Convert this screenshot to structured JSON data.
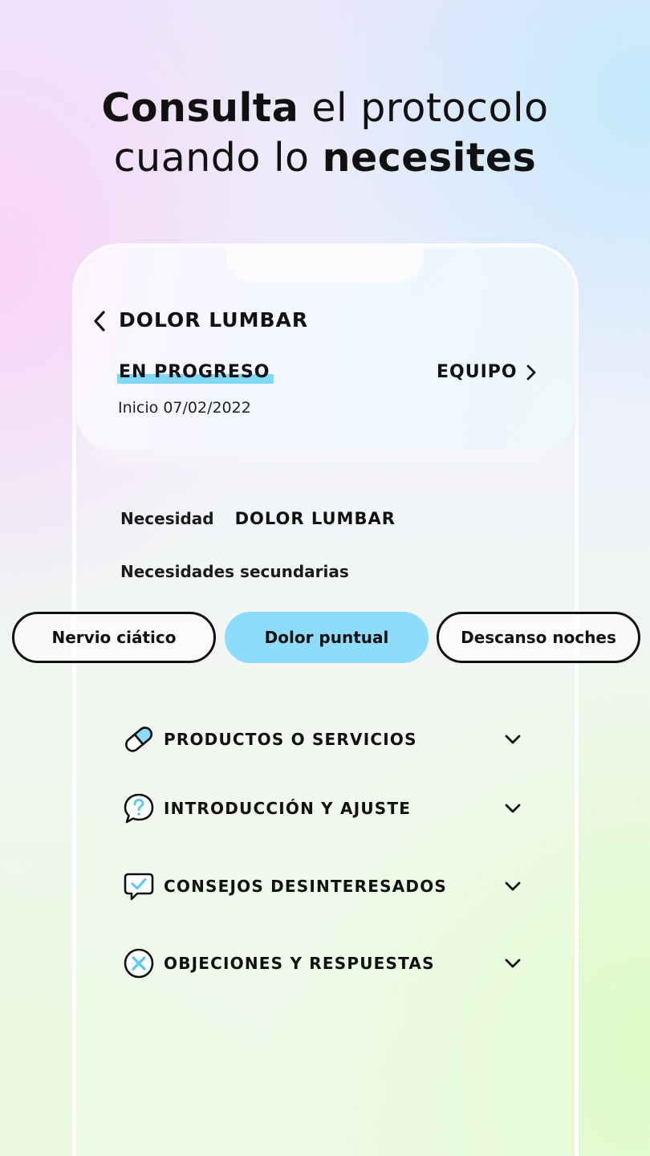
{
  "headline": {
    "line1_bold": "Consulta",
    "line1_rest": " el protocolo",
    "line2_start": "cuando lo ",
    "line2_bold": "necesites"
  },
  "header": {
    "title": "DOLOR LUMBAR",
    "status": "EN PROGRESO",
    "start_date": "Inicio 07/02/2022",
    "team_link": "EQUIPO"
  },
  "needs": {
    "need_label": "Necesidad",
    "need_value": "DOLOR LUMBAR",
    "secondary_label": "Necesidades secundarias",
    "chips": [
      {
        "label": "Nervio ciático",
        "selected": false
      },
      {
        "label": "Dolor puntual",
        "selected": true
      },
      {
        "label": "Descanso noches",
        "selected": false
      }
    ]
  },
  "sections": [
    {
      "label": "PRODUCTOS O SERVICIOS",
      "icon": "pill-icon"
    },
    {
      "label": "INTRODUCCIÓN Y AJUSTE",
      "icon": "question-bubble-icon"
    },
    {
      "label": "CONSEJOS DESINTERESADOS",
      "icon": "check-bubble-icon"
    },
    {
      "label": "OBJECIONES Y RESPUESTAS",
      "icon": "x-circle-icon"
    }
  ],
  "colors": {
    "accent": "#8ddcfb",
    "status_underline": "#7fd9f6",
    "text": "#111111"
  }
}
